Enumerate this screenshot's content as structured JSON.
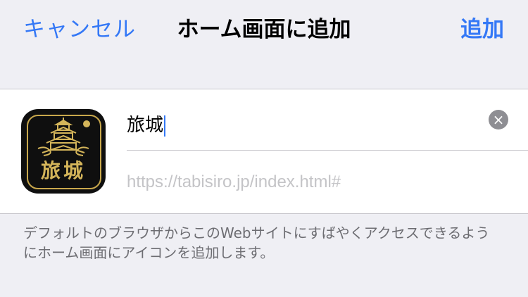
{
  "navbar": {
    "cancel_label": "キャンセル",
    "title": "ホーム画面に追加",
    "add_label": "追加"
  },
  "app": {
    "icon_text": "旅城",
    "name_value": "旅城",
    "url": "https://tabisiro.jp/index.html#"
  },
  "footer": {
    "note": "デフォルトのブラウザからこのWebサイトにすばやくアクセスできるようにホーム画面にアイコンを追加します。"
  },
  "colors": {
    "accent": "#3478f6",
    "background": "#efeff4",
    "icon_gold": "#d4b55a"
  }
}
